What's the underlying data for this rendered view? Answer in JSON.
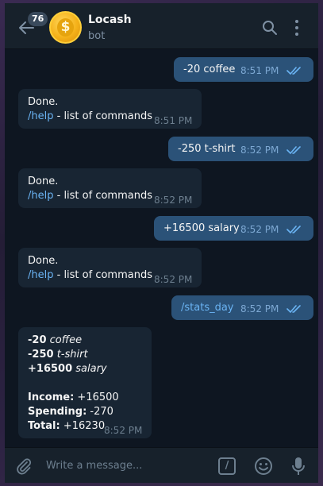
{
  "header": {
    "unread_count": "76",
    "title": "Locash",
    "status": "bot",
    "avatar_symbol": "$"
  },
  "messages": [
    {
      "direction": "out",
      "text": "-20 coffee",
      "time": "8:51 PM",
      "read": true
    },
    {
      "direction": "in",
      "line1": "Done.",
      "link": "/help",
      "rest": " - list of commands",
      "time": "8:51 PM"
    },
    {
      "direction": "out",
      "text": "-250 t-shirt",
      "time": "8:52 PM",
      "read": true
    },
    {
      "direction": "in",
      "line1": "Done.",
      "link": "/help",
      "rest": " - list of commands",
      "time": "8:52 PM"
    },
    {
      "direction": "out",
      "text": "+16500 salary",
      "time": "8:52 PM",
      "read": true
    },
    {
      "direction": "in",
      "line1": "Done.",
      "link": "/help",
      "rest": " - list of commands",
      "time": "8:52 PM"
    },
    {
      "direction": "out",
      "text": "/stats_day",
      "time": "8:52 PM",
      "read": true
    },
    {
      "direction": "in",
      "entries": [
        {
          "amount": "-20",
          "label": "coffee"
        },
        {
          "amount": "-250",
          "label": "t-shirt"
        },
        {
          "amount": "+16500",
          "label": "salary"
        }
      ],
      "totals": [
        {
          "label": "Income:",
          "value": " +16500"
        },
        {
          "label": "Spending:",
          "value": " -270"
        },
        {
          "label": "Total:",
          "value": " +16230"
        }
      ],
      "time": "8:52 PM"
    }
  ],
  "composer": {
    "placeholder": "Write a message...",
    "command_symbol": "/"
  },
  "colors": {
    "outgoing_bubble": "#2b5278",
    "incoming_bubble": "#182533",
    "link": "#6ab3f3",
    "background": "#0e1621"
  }
}
